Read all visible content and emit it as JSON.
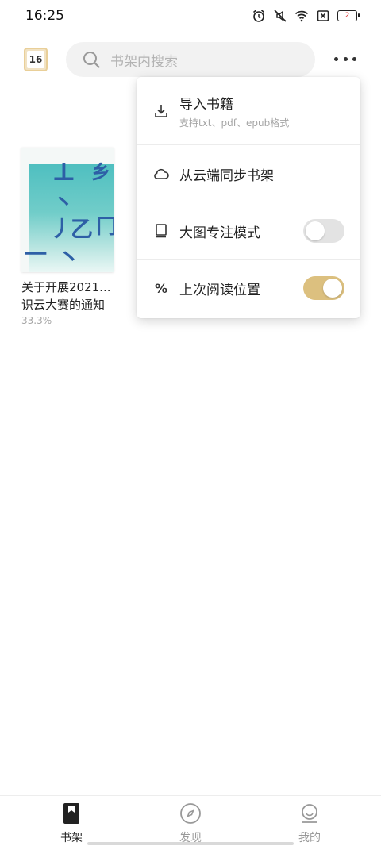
{
  "status_bar": {
    "time": "16:25",
    "icons": [
      "alarm-icon",
      "mute-icon",
      "wifi-icon",
      "sim-off-icon",
      "battery-icon"
    ],
    "battery_level": "2"
  },
  "header": {
    "calendar_day": "16",
    "search_placeholder": "书架内搜索",
    "search_icon": "search-icon",
    "more_icon": "more-dots-icon"
  },
  "books": [
    {
      "title": "关于开展2021...识云大赛的通知",
      "title_line1": "关于开展2021...",
      "title_line2": "识云大赛的通知",
      "progress": "33.3%"
    }
  ],
  "menu": {
    "items": [
      {
        "icon": "download-icon",
        "label": "导入书籍",
        "sub": "支持txt、pdf、epub格式"
      },
      {
        "icon": "cloud-icon",
        "label": "从云端同步书架"
      },
      {
        "icon": "book-icon",
        "label": "大图专注模式",
        "toggle": false
      },
      {
        "icon": "percent-icon",
        "label": "上次阅读位置",
        "toggle": true
      }
    ],
    "percent_glyph": "%"
  },
  "bottom_nav": {
    "items": [
      {
        "icon": "bookshelf-icon",
        "label": "书架",
        "active": true
      },
      {
        "icon": "compass-icon",
        "label": "发现",
        "active": false
      },
      {
        "icon": "profile-icon",
        "label": "我的",
        "active": false
      }
    ]
  },
  "colors": {
    "accent": "#dcc07f",
    "toggle_off": "#e3e3e3",
    "search_bg": "#f2f2f2",
    "cover_teal": "#4fbfc0",
    "cover_ink": "#2d5fa6"
  }
}
